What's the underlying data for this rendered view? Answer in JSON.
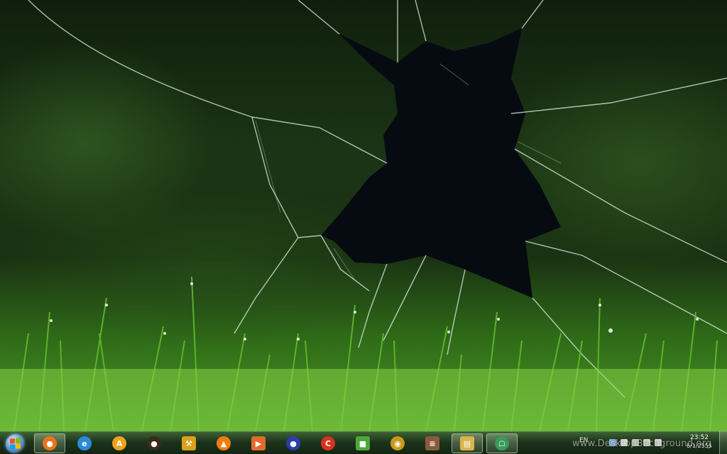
{
  "taskbar": {
    "start_button_label": "Start",
    "pinned": [
      {
        "icon": "firefox-icon",
        "glyph": "●",
        "color": "#e8741c",
        "active": true
      },
      {
        "icon": "internet-explorer-icon",
        "glyph": "e",
        "color": "#2a8ad8",
        "active": false
      },
      {
        "icon": "aimp-icon",
        "glyph": "A",
        "color": "#f2a21a",
        "active": false
      },
      {
        "icon": "media-player-icon",
        "glyph": "●",
        "color": "#3a2a1a",
        "active": false
      },
      {
        "icon": "tools-icon",
        "glyph": "⚒",
        "color": "#d9a21c",
        "active": false
      },
      {
        "icon": "vlc-icon",
        "glyph": "▲",
        "color": "#f07c10",
        "active": false
      },
      {
        "icon": "video-player-icon",
        "glyph": "▶",
        "color": "#e36b2a",
        "active": false
      },
      {
        "icon": "globe-icon",
        "glyph": "●",
        "color": "#2a3fa8",
        "active": false
      },
      {
        "icon": "ccleaner-icon",
        "glyph": "C",
        "color": "#d8321e",
        "active": false
      },
      {
        "icon": "windows-live-icon",
        "glyph": "■",
        "color": "#4aa83a",
        "active": false
      },
      {
        "icon": "disc-burner-icon",
        "glyph": "◉",
        "color": "#c89a1a",
        "active": false
      },
      {
        "icon": "media-center-icon",
        "glyph": "≡",
        "color": "#8a5a3a",
        "active": false
      },
      {
        "icon": "folder-icon",
        "glyph": "▤",
        "color": "#d9b54a",
        "active": true
      },
      {
        "icon": "network-icon",
        "glyph": "☖",
        "color": "#3a9a5a",
        "active": true
      }
    ],
    "tray": {
      "language": "EN",
      "time": "23:52",
      "date": "6/1/2555"
    }
  },
  "watermark": "www.DesktopBackground.org",
  "colors": {
    "taskbar_top": "#466e3c",
    "taskbar_bottom": "#122612",
    "grass": "#4d9a24"
  }
}
